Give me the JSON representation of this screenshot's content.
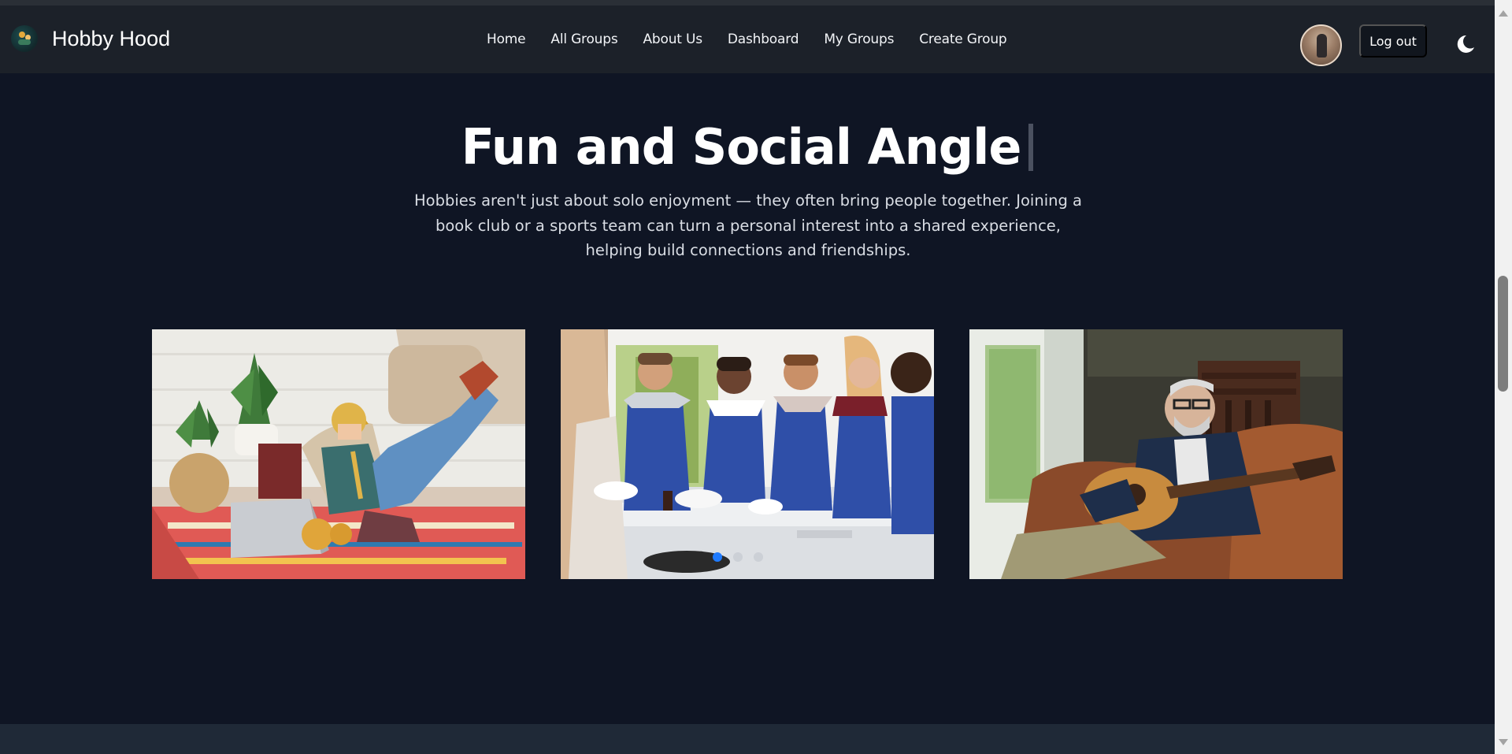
{
  "app": {
    "brand_name": "Hobby Hood"
  },
  "nav": {
    "links": [
      "Home",
      "All Groups",
      "About Us",
      "Dashboard",
      "My Groups",
      "Create Group"
    ],
    "logout_label": "Log out"
  },
  "hero": {
    "title": "Fun and Social Angle",
    "description": "Hobbies aren't just about solo enjoyment — they often bring people together. Joining a book club or a sports team can turn a personal interest into a shared experience, helping build connections and friendships."
  },
  "carousel": {
    "active_index": 0,
    "slide_count": 3
  },
  "colors": {
    "background": "#0f1524",
    "navbar": "#1c2129",
    "accent": "#1f7bff"
  }
}
